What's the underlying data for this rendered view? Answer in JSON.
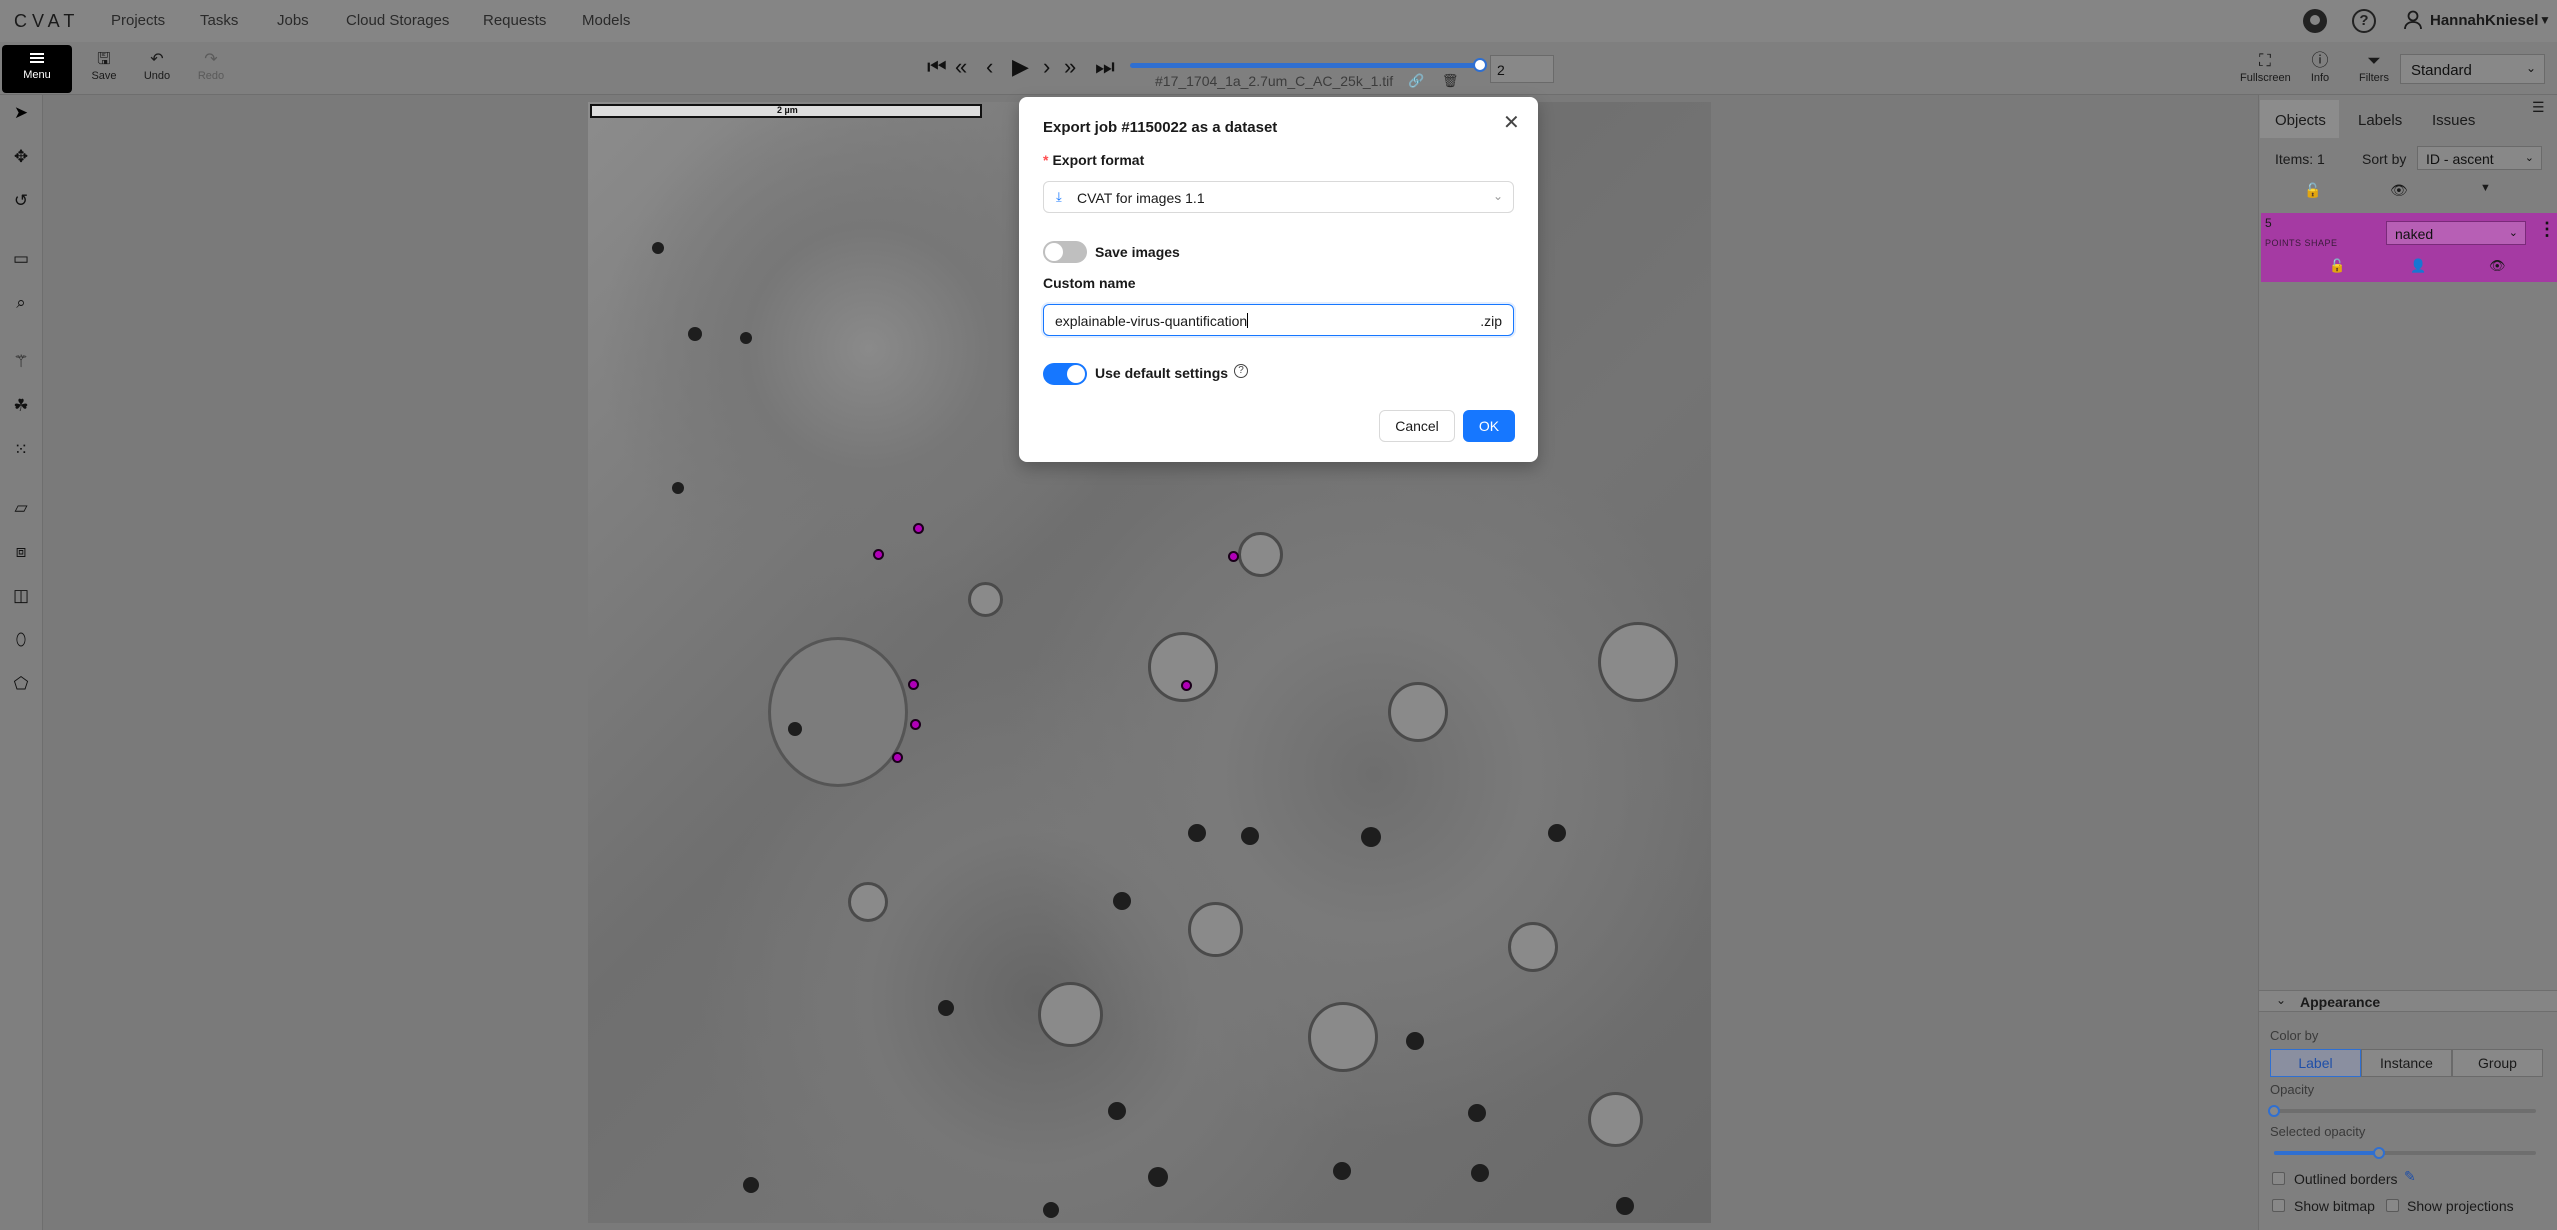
{
  "app": {
    "logo": "CVAT",
    "nav": [
      "Projects",
      "Tasks",
      "Jobs",
      "Cloud Storages",
      "Requests",
      "Models"
    ],
    "username": "HannahKniesel"
  },
  "toolbar": {
    "menu_label": "Menu",
    "save_label": "Save",
    "undo_label": "Undo",
    "redo_label": "Redo",
    "frame_number": "2",
    "frame_progress": 1.0,
    "filename": "#17_1704_1a_2.7um_C_AC_25k_1.tif",
    "fullscreen_label": "Fullscreen",
    "info_label": "Info",
    "filters_label": "Filters",
    "workspace_mode": "Standard"
  },
  "canvas": {
    "scale_bar_label": "2 µm"
  },
  "right_panel": {
    "tabs": [
      "Objects",
      "Labels",
      "Issues"
    ],
    "items_label": "Items: 1",
    "sort_by_label": "Sort by",
    "sort_value": "ID - ascent",
    "object": {
      "id": "5",
      "type": "POINTS SHAPE",
      "label": "naked",
      "color": "#a53aa3"
    },
    "appearance": {
      "title": "Appearance",
      "color_by_label": "Color by",
      "color_by_options": [
        "Label",
        "Instance",
        "Group"
      ],
      "color_by_selected": "Label",
      "opacity_label": "Opacity",
      "opacity_value": 0.0,
      "selected_opacity_label": "Selected opacity",
      "selected_opacity_value": 0.4,
      "outlined_borders_label": "Outlined borders",
      "show_bitmap_label": "Show bitmap",
      "show_projections_label": "Show projections"
    }
  },
  "modal": {
    "title": "Export job #1150022 as a dataset",
    "export_format_label": "Export format",
    "export_format_value": "CVAT for images 1.1",
    "save_images_label": "Save images",
    "save_images_on": false,
    "custom_name_label": "Custom name",
    "custom_name_value": "explainable-virus-quantification",
    "custom_name_suffix": ".zip",
    "use_default_settings_label": "Use default settings",
    "use_default_settings_on": true,
    "cancel_label": "Cancel",
    "ok_label": "OK"
  },
  "colors": {
    "accent": "#1677ff",
    "overlay_page": "#7a7a7a",
    "point_marker": "#b000b8"
  }
}
